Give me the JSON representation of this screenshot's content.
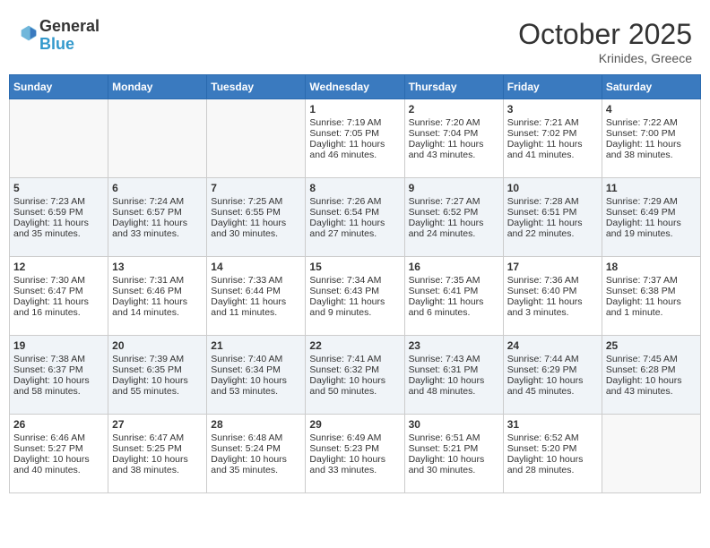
{
  "header": {
    "logo_general": "General",
    "logo_blue": "Blue",
    "month": "October 2025",
    "location": "Krinides, Greece"
  },
  "weekdays": [
    "Sunday",
    "Monday",
    "Tuesday",
    "Wednesday",
    "Thursday",
    "Friday",
    "Saturday"
  ],
  "weeks": [
    [
      {
        "day": "",
        "text": ""
      },
      {
        "day": "",
        "text": ""
      },
      {
        "day": "",
        "text": ""
      },
      {
        "day": "1",
        "text": "Sunrise: 7:19 AM\nSunset: 7:05 PM\nDaylight: 11 hours and 46 minutes."
      },
      {
        "day": "2",
        "text": "Sunrise: 7:20 AM\nSunset: 7:04 PM\nDaylight: 11 hours and 43 minutes."
      },
      {
        "day": "3",
        "text": "Sunrise: 7:21 AM\nSunset: 7:02 PM\nDaylight: 11 hours and 41 minutes."
      },
      {
        "day": "4",
        "text": "Sunrise: 7:22 AM\nSunset: 7:00 PM\nDaylight: 11 hours and 38 minutes."
      }
    ],
    [
      {
        "day": "5",
        "text": "Sunrise: 7:23 AM\nSunset: 6:59 PM\nDaylight: 11 hours and 35 minutes."
      },
      {
        "day": "6",
        "text": "Sunrise: 7:24 AM\nSunset: 6:57 PM\nDaylight: 11 hours and 33 minutes."
      },
      {
        "day": "7",
        "text": "Sunrise: 7:25 AM\nSunset: 6:55 PM\nDaylight: 11 hours and 30 minutes."
      },
      {
        "day": "8",
        "text": "Sunrise: 7:26 AM\nSunset: 6:54 PM\nDaylight: 11 hours and 27 minutes."
      },
      {
        "day": "9",
        "text": "Sunrise: 7:27 AM\nSunset: 6:52 PM\nDaylight: 11 hours and 24 minutes."
      },
      {
        "day": "10",
        "text": "Sunrise: 7:28 AM\nSunset: 6:51 PM\nDaylight: 11 hours and 22 minutes."
      },
      {
        "day": "11",
        "text": "Sunrise: 7:29 AM\nSunset: 6:49 PM\nDaylight: 11 hours and 19 minutes."
      }
    ],
    [
      {
        "day": "12",
        "text": "Sunrise: 7:30 AM\nSunset: 6:47 PM\nDaylight: 11 hours and 16 minutes."
      },
      {
        "day": "13",
        "text": "Sunrise: 7:31 AM\nSunset: 6:46 PM\nDaylight: 11 hours and 14 minutes."
      },
      {
        "day": "14",
        "text": "Sunrise: 7:33 AM\nSunset: 6:44 PM\nDaylight: 11 hours and 11 minutes."
      },
      {
        "day": "15",
        "text": "Sunrise: 7:34 AM\nSunset: 6:43 PM\nDaylight: 11 hours and 9 minutes."
      },
      {
        "day": "16",
        "text": "Sunrise: 7:35 AM\nSunset: 6:41 PM\nDaylight: 11 hours and 6 minutes."
      },
      {
        "day": "17",
        "text": "Sunrise: 7:36 AM\nSunset: 6:40 PM\nDaylight: 11 hours and 3 minutes."
      },
      {
        "day": "18",
        "text": "Sunrise: 7:37 AM\nSunset: 6:38 PM\nDaylight: 11 hours and 1 minute."
      }
    ],
    [
      {
        "day": "19",
        "text": "Sunrise: 7:38 AM\nSunset: 6:37 PM\nDaylight: 10 hours and 58 minutes."
      },
      {
        "day": "20",
        "text": "Sunrise: 7:39 AM\nSunset: 6:35 PM\nDaylight: 10 hours and 55 minutes."
      },
      {
        "day": "21",
        "text": "Sunrise: 7:40 AM\nSunset: 6:34 PM\nDaylight: 10 hours and 53 minutes."
      },
      {
        "day": "22",
        "text": "Sunrise: 7:41 AM\nSunset: 6:32 PM\nDaylight: 10 hours and 50 minutes."
      },
      {
        "day": "23",
        "text": "Sunrise: 7:43 AM\nSunset: 6:31 PM\nDaylight: 10 hours and 48 minutes."
      },
      {
        "day": "24",
        "text": "Sunrise: 7:44 AM\nSunset: 6:29 PM\nDaylight: 10 hours and 45 minutes."
      },
      {
        "day": "25",
        "text": "Sunrise: 7:45 AM\nSunset: 6:28 PM\nDaylight: 10 hours and 43 minutes."
      }
    ],
    [
      {
        "day": "26",
        "text": "Sunrise: 6:46 AM\nSunset: 5:27 PM\nDaylight: 10 hours and 40 minutes."
      },
      {
        "day": "27",
        "text": "Sunrise: 6:47 AM\nSunset: 5:25 PM\nDaylight: 10 hours and 38 minutes."
      },
      {
        "day": "28",
        "text": "Sunrise: 6:48 AM\nSunset: 5:24 PM\nDaylight: 10 hours and 35 minutes."
      },
      {
        "day": "29",
        "text": "Sunrise: 6:49 AM\nSunset: 5:23 PM\nDaylight: 10 hours and 33 minutes."
      },
      {
        "day": "30",
        "text": "Sunrise: 6:51 AM\nSunset: 5:21 PM\nDaylight: 10 hours and 30 minutes."
      },
      {
        "day": "31",
        "text": "Sunrise: 6:52 AM\nSunset: 5:20 PM\nDaylight: 10 hours and 28 minutes."
      },
      {
        "day": "",
        "text": ""
      }
    ]
  ]
}
